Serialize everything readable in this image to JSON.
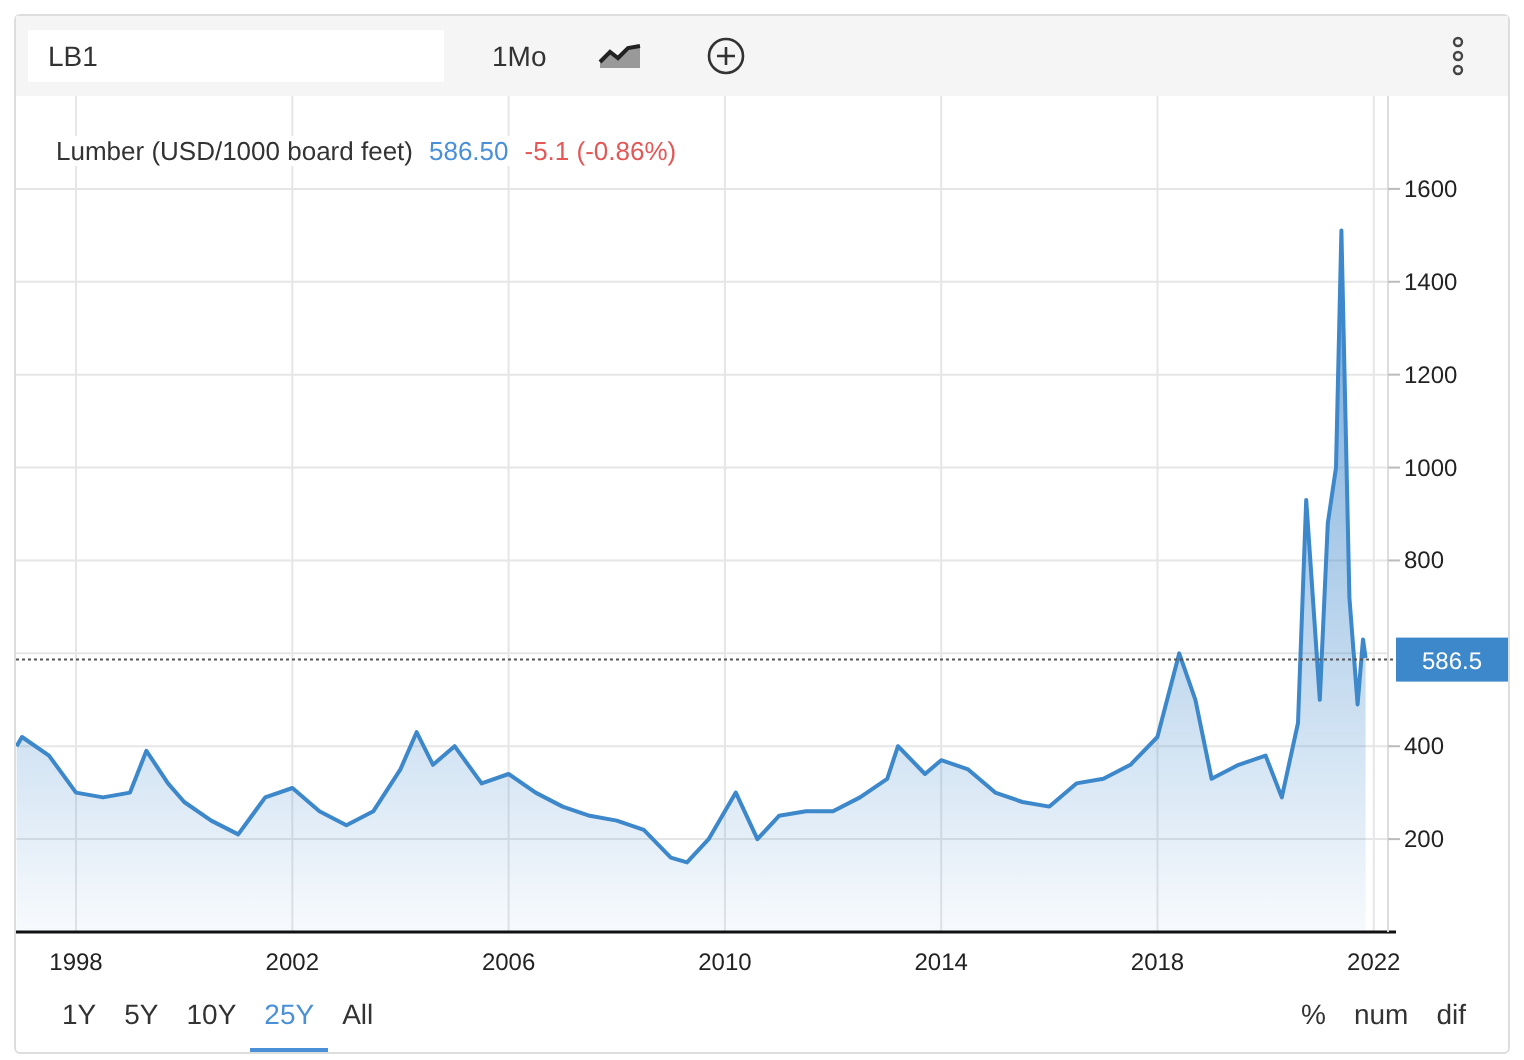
{
  "toolbar": {
    "symbol": "LB1",
    "interval": "1Mo"
  },
  "legend": {
    "price": "586.50",
    "change": "-5.1 (-0.86%)"
  },
  "chart_data": {
    "type": "area",
    "xlim": [
      1996.89,
      2022.3
    ],
    "ylim": [
      0,
      1800
    ],
    "x": [
      1996.9,
      1997.0,
      1997.5,
      1998,
      1998.5,
      1999,
      1999.3,
      1999.7,
      2000,
      2000.5,
      2001,
      2001.5,
      2002,
      2002.5,
      2003,
      2003.5,
      2004,
      2004.3,
      2004.6,
      2005,
      2005.5,
      2006,
      2006.5,
      2007,
      2007.5,
      2008,
      2008.5,
      2009,
      2009.3,
      2009.7,
      2010.2,
      2010.6,
      2011,
      2011.5,
      2012,
      2012.5,
      2013,
      2013.2,
      2013.7,
      2014,
      2014.5,
      2015,
      2015.5,
      2016,
      2016.5,
      2017,
      2017.5,
      2018,
      2018.4,
      2018.7,
      2019,
      2019.5,
      2020,
      2020.3,
      2020.6,
      2020.75,
      2021.0,
      2021.15,
      2021.3,
      2021.4,
      2021.55,
      2021.7,
      2021.8,
      2021.85
    ],
    "series": [
      {
        "name": "Lumber (USD/1000 board feet)",
        "color": "#3d87cb",
        "values": [
          400,
          420,
          380,
          300,
          290,
          300,
          390,
          320,
          280,
          240,
          210,
          290,
          310,
          260,
          230,
          260,
          350,
          430,
          360,
          400,
          320,
          340,
          300,
          270,
          250,
          240,
          220,
          160,
          150,
          200,
          300,
          200,
          250,
          260,
          260,
          290,
          330,
          400,
          340,
          370,
          350,
          300,
          280,
          270,
          320,
          330,
          360,
          420,
          600,
          500,
          330,
          360,
          380,
          290,
          450,
          930,
          500,
          880,
          1000,
          1510,
          720,
          490,
          630,
          590
        ]
      }
    ],
    "xticks": [
      1998,
      2002,
      2006,
      2010,
      2014,
      2018,
      2022
    ],
    "yticks": [
      200,
      400,
      800,
      1000,
      1200,
      1400,
      1600
    ],
    "grid": true,
    "ref_lines": [
      {
        "axis": "y",
        "value": 586.5,
        "label": "586.5"
      }
    ]
  },
  "ranges": [
    {
      "label": "1Y",
      "selected": false
    },
    {
      "label": "5Y",
      "selected": false
    },
    {
      "label": "10Y",
      "selected": false
    },
    {
      "label": "25Y",
      "selected": true
    },
    {
      "label": "All",
      "selected": false
    }
  ],
  "modes": [
    "%",
    "num",
    "dif"
  ]
}
